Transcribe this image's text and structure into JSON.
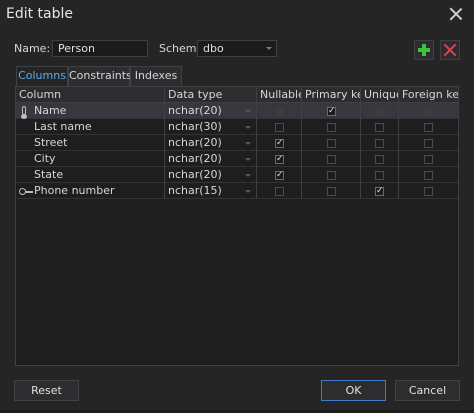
{
  "window": {
    "title": "Edit table"
  },
  "form": {
    "name_label": "Name:",
    "name_value": "Person",
    "schema_label": "Schema:",
    "schema_value": "dbo"
  },
  "toolbar": {
    "add_icon": "plus-icon",
    "delete_icon": "x-icon",
    "add_color": "#3fc23f",
    "delete_color": "#e04343"
  },
  "tabs": [
    {
      "label": "Columns",
      "active": true
    },
    {
      "label": "Constraints",
      "active": false
    },
    {
      "label": "Indexes",
      "active": false
    }
  ],
  "grid": {
    "headers": [
      "Column",
      "Data type",
      "Nullable",
      "Primary key",
      "Unique",
      "Foreign key"
    ],
    "rows": [
      {
        "marker": "thermometer-key-icon",
        "column": "Name",
        "type": "nchar(20)",
        "nullable": false,
        "primary": true,
        "unique": false,
        "foreign": false,
        "selected": true
      },
      {
        "marker": "",
        "column": "Last name",
        "type": "nchar(30)",
        "nullable": false,
        "primary": false,
        "unique": false,
        "foreign": false,
        "selected": false
      },
      {
        "marker": "",
        "column": "Street",
        "type": "nchar(20)",
        "nullable": true,
        "primary": false,
        "unique": false,
        "foreign": false,
        "selected": false
      },
      {
        "marker": "",
        "column": "City",
        "type": "nchar(20)",
        "nullable": true,
        "primary": false,
        "unique": false,
        "foreign": false,
        "selected": false
      },
      {
        "marker": "",
        "column": "State",
        "type": "nchar(20)",
        "nullable": true,
        "primary": false,
        "unique": false,
        "foreign": false,
        "selected": false
      },
      {
        "marker": "key-icon",
        "column": "Phone number",
        "type": "nchar(15)",
        "nullable": false,
        "primary": false,
        "unique": true,
        "foreign": false,
        "selected": false
      }
    ]
  },
  "buttons": {
    "reset": "Reset",
    "ok": "OK",
    "cancel": "Cancel"
  },
  "colors": {
    "accent": "#3e7ccb",
    "active_tab": "#5aa8f0"
  }
}
